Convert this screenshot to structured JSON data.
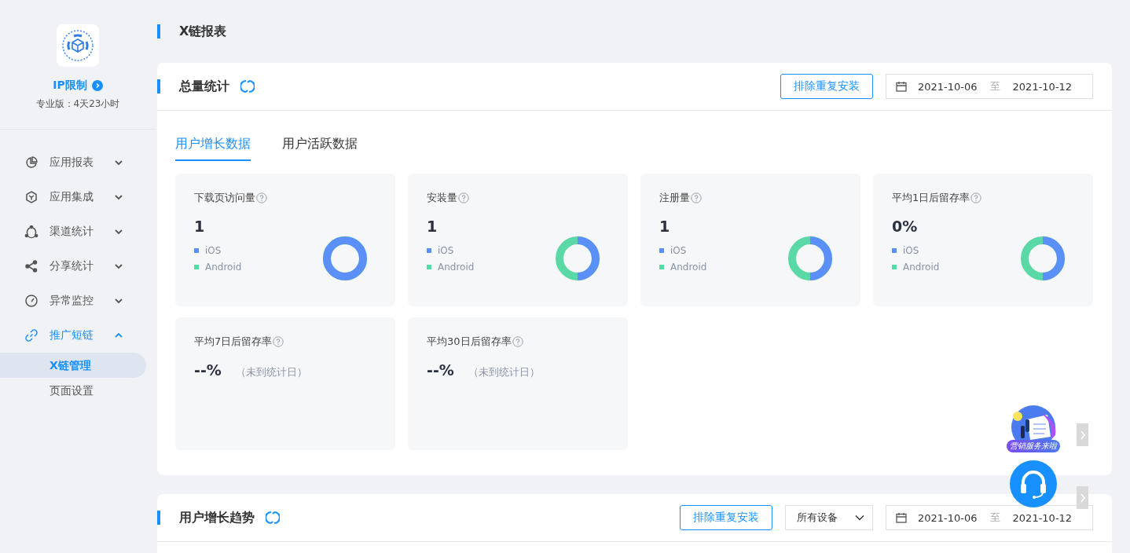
{
  "sidebar": {
    "app_name": "IP限制",
    "plan": "专业版：4天23小时",
    "items": [
      {
        "label": "应用报表",
        "expanded": false
      },
      {
        "label": "应用集成",
        "expanded": false
      },
      {
        "label": "渠道统计",
        "expanded": false
      },
      {
        "label": "分享统计",
        "expanded": false
      },
      {
        "label": "异常监控",
        "expanded": false
      },
      {
        "label": "推广短链",
        "expanded": true,
        "children": [
          {
            "label": "X链管理",
            "selected": true
          },
          {
            "label": "页面设置",
            "selected": false
          }
        ]
      }
    ]
  },
  "page_title": "X链报表",
  "summary": {
    "title": "总量统计",
    "exclude_button": "排除重复安装",
    "date_from": "2021-10-06",
    "date_sep": "至",
    "date_to": "2021-10-12",
    "tabs": [
      {
        "label": "用户增长数据",
        "selected": true
      },
      {
        "label": "用户活跃数据",
        "selected": false
      }
    ],
    "stats": [
      {
        "kind": "donut",
        "label": "下载页访问量",
        "value": "1",
        "legend": [
          {
            "label": "iOS",
            "color": "#5b8ff9"
          },
          {
            "label": "Android",
            "color": "#5ad8a6"
          }
        ],
        "level": 1
      },
      {
        "kind": "donut",
        "label": "安装量",
        "value": "1",
        "legend": [
          {
            "label": "iOS",
            "color": "#5b8ff9"
          },
          {
            "label": "Android",
            "color": "#5ad8a6"
          }
        ],
        "level": 0.5
      },
      {
        "kind": "donut",
        "label": "注册量",
        "value": "1",
        "legend": [
          {
            "label": "iOS",
            "color": "#5b8ff9"
          },
          {
            "label": "Android",
            "color": "#5ad8a6"
          }
        ],
        "level": 0.5
      },
      {
        "kind": "donut",
        "label": "平均1日后留存率",
        "value": "0%",
        "legend": [
          {
            "label": "iOS",
            "color": "#5b8ff9"
          },
          {
            "label": "Android",
            "color": "#5ad8a6"
          }
        ],
        "level": 0.5
      },
      {
        "kind": "pending",
        "label": "平均7日后留存率",
        "value": "--%",
        "note": "（未到统计日）"
      },
      {
        "kind": "pending",
        "label": "平均30日后留存率",
        "value": "--%",
        "note": "（未到统计日）"
      }
    ]
  },
  "trend": {
    "title": "用户增长趋势",
    "exclude_button": "排除重复安装",
    "device_select": "所有设备",
    "date_from": "2021-10-06",
    "date_sep": "至",
    "date_to": "2021-10-12"
  },
  "promo_badge": "营销服务来啦"
}
